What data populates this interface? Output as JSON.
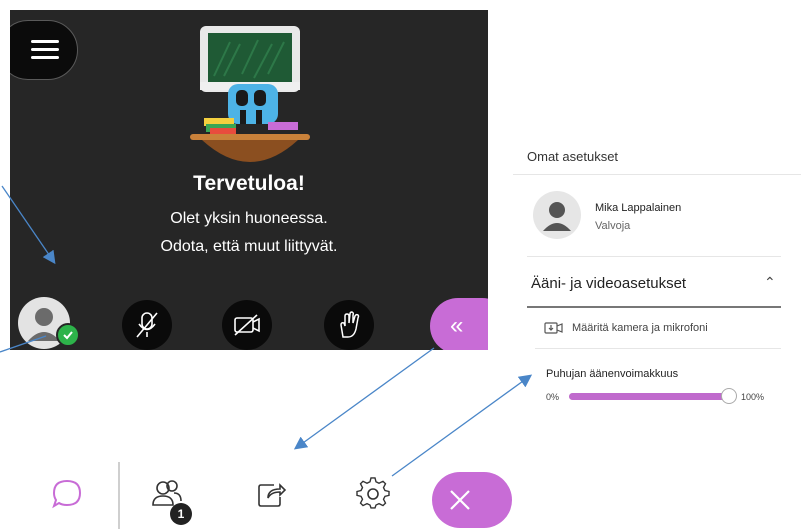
{
  "session": {
    "welcome_title": "Tervetuloa!",
    "welcome_line1": "Olet yksin huoneessa.",
    "welcome_line2": "Odota, että muut liittyvät.",
    "collapse_glyph": "«",
    "controls": [
      {
        "name": "avatar",
        "icon": "user-avatar-icon",
        "status": "ready-check-icon"
      },
      {
        "name": "microphone",
        "icon": "mic-off-icon"
      },
      {
        "name": "camera",
        "icon": "camera-off-icon"
      },
      {
        "name": "hand",
        "icon": "raise-hand-icon"
      }
    ]
  },
  "settings": {
    "title": "Omat asetukset",
    "user_name": "Mika Lappalainen",
    "user_role": "Valvoja",
    "section_title": "Ääni- ja videoasetukset",
    "camera_setup": "Määritä kamera ja mikrofoni",
    "volume_label": "Puhujan äänenvoimakkuus",
    "volume_min": "0%",
    "volume_max": "100%",
    "volume_level": 0.97
  },
  "toolbar": {
    "items": [
      "chat-icon",
      "participants-icon",
      "share-content-icon",
      "settings-gear-icon"
    ],
    "participants_badge": "1",
    "close_glyph": "✕"
  },
  "colors": {
    "accent": "#c86cd6",
    "session_bg": "#262626",
    "status_green": "#2db34a",
    "arrow": "#4a86c8"
  }
}
